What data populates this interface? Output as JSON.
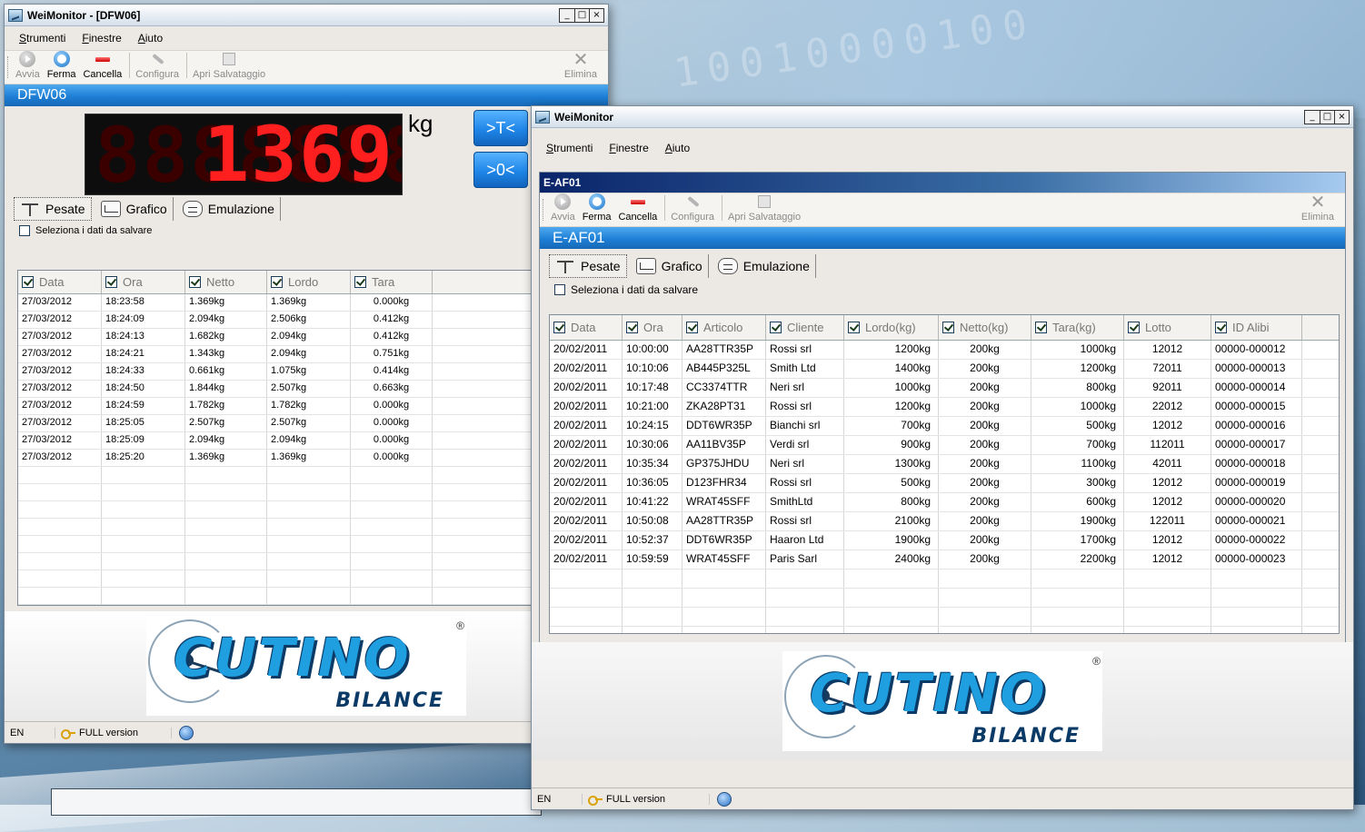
{
  "background": {
    "digits": "10010000100"
  },
  "left_window": {
    "title": "WeiMonitor - [DFW06]",
    "controls": [
      "_",
      "□",
      "×"
    ],
    "menu": [
      {
        "label": "Strumenti",
        "accel": "S",
        "rest": "trumenti"
      },
      {
        "label": "Finestre",
        "accel": "F",
        "rest": "inestre"
      },
      {
        "label": "Aiuto",
        "accel": "A",
        "rest": "iuto"
      }
    ],
    "toolbar": {
      "avvia": "Avvia",
      "ferma": "Ferma",
      "cancella": "Cancella",
      "configura": "Configura",
      "apri": "Apri Salvataggio",
      "elimina": "Elimina"
    },
    "device": "DFW06",
    "display": {
      "value": "1369",
      "ghost": "88888888",
      "unit": "kg"
    },
    "buttons": {
      "tare": ">T<",
      "zero": ">0<"
    },
    "tabs": [
      "Pesate",
      "Grafico",
      "Emulazione"
    ],
    "select_label": "Seleziona i dati da salvare",
    "columns": [
      "Data",
      "Ora",
      "Netto",
      "Lordo",
      "Tara"
    ],
    "rows": [
      [
        "27/03/2012",
        "18:23:58",
        "1.369kg",
        "1.369kg",
        "0.000kg"
      ],
      [
        "27/03/2012",
        "18:24:09",
        "2.094kg",
        "2.506kg",
        "0.412kg"
      ],
      [
        "27/03/2012",
        "18:24:13",
        "1.682kg",
        "2.094kg",
        "0.412kg"
      ],
      [
        "27/03/2012",
        "18:24:21",
        "1.343kg",
        "2.094kg",
        "0.751kg"
      ],
      [
        "27/03/2012",
        "18:24:33",
        "0.661kg",
        "1.075kg",
        "0.414kg"
      ],
      [
        "27/03/2012",
        "18:24:50",
        "1.844kg",
        "2.507kg",
        "0.663kg"
      ],
      [
        "27/03/2012",
        "18:24:59",
        "1.782kg",
        "1.782kg",
        "0.000kg"
      ],
      [
        "27/03/2012",
        "18:25:05",
        "2.507kg",
        "2.507kg",
        "0.000kg"
      ],
      [
        "27/03/2012",
        "18:25:09",
        "2.094kg",
        "2.094kg",
        "0.000kg"
      ],
      [
        "27/03/2012",
        "18:25:20",
        "1.369kg",
        "1.369kg",
        "0.000kg"
      ]
    ],
    "logo": {
      "brand": "CUTINO",
      "sub": "BILANCE",
      "reg": "®"
    },
    "status": {
      "lang": "EN",
      "version": "FULL version"
    }
  },
  "right_window": {
    "title": "WeiMonitor",
    "controls": [
      "_",
      "□",
      "×"
    ],
    "menu": [
      {
        "label": "Strumenti",
        "accel": "S",
        "rest": "trumenti"
      },
      {
        "label": "Finestre",
        "accel": "F",
        "rest": "inestre"
      },
      {
        "label": "Aiuto",
        "accel": "A",
        "rest": "iuto"
      }
    ],
    "child_title": "E-AF01",
    "toolbar": {
      "avvia": "Avvia",
      "ferma": "Ferma",
      "cancella": "Cancella",
      "configura": "Configura",
      "apri": "Apri Salvataggio",
      "elimina": "Elimina"
    },
    "device": "E-AF01",
    "tabs": [
      "Pesate",
      "Grafico",
      "Emulazione"
    ],
    "select_label": "Seleziona i dati da salvare",
    "columns": [
      "Data",
      "Ora",
      "Articolo",
      "Cliente",
      "Lordo(kg)",
      "Netto(kg)",
      "Tara(kg)",
      "Lotto",
      "ID Alibi"
    ],
    "rows": [
      [
        "20/02/2011",
        "10:00:00",
        "AA28TTR35P",
        "Rossi srl",
        "1200kg",
        "200kg",
        "1000kg",
        "12012",
        "00000-000012"
      ],
      [
        "20/02/2011",
        "10:10:06",
        "AB445P325L",
        "Smith Ltd",
        "1400kg",
        "200kg",
        "1200kg",
        "72011",
        "00000-000013"
      ],
      [
        "20/02/2011",
        "10:17:48",
        "CC3374TTR",
        "Neri srl",
        "1000kg",
        "200kg",
        "800kg",
        "92011",
        "00000-000014"
      ],
      [
        "20/02/2011",
        "10:21:00",
        "ZKA28PT31",
        "Rossi srl",
        "1200kg",
        "200kg",
        "1000kg",
        "22012",
        "00000-000015"
      ],
      [
        "20/02/2011",
        "10:24:15",
        "DDT6WR35P",
        "Bianchi srl",
        "700kg",
        "200kg",
        "500kg",
        "12012",
        "00000-000016"
      ],
      [
        "20/02/2011",
        "10:30:06",
        "AA11BV35P",
        "Verdi srl",
        "900kg",
        "200kg",
        "700kg",
        "112011",
        "00000-000017"
      ],
      [
        "20/02/2011",
        "10:35:34",
        "GP375JHDU",
        "Neri srl",
        "1300kg",
        "200kg",
        "1100kg",
        "42011",
        "00000-000018"
      ],
      [
        "20/02/2011",
        "10:36:05",
        "D123FHR34",
        "Rossi srl",
        "500kg",
        "200kg",
        "300kg",
        "12012",
        "00000-000019"
      ],
      [
        "20/02/2011",
        "10:41:22",
        "WRAT45SFF",
        "SmithLtd",
        "800kg",
        "200kg",
        "600kg",
        "12012",
        "00000-000020"
      ],
      [
        "20/02/2011",
        "10:50:08",
        "AA28TTR35P",
        "Rossi srl",
        "2100kg",
        "200kg",
        "1900kg",
        "122011",
        "00000-000021"
      ],
      [
        "20/02/2011",
        "10:52:37",
        "DDT6WR35P",
        "Haaron Ltd",
        "1900kg",
        "200kg",
        "1700kg",
        "12012",
        "00000-000022"
      ],
      [
        "20/02/2011",
        "10:59:59",
        "WRAT45SFF",
        "Paris Sarl",
        "2400kg",
        "200kg",
        "2200kg",
        "12012",
        "00000-000023"
      ]
    ],
    "logo": {
      "brand": "CUTINO",
      "sub": "BILANCE",
      "reg": "®"
    },
    "status": {
      "lang": "EN",
      "version": "FULL version"
    }
  }
}
